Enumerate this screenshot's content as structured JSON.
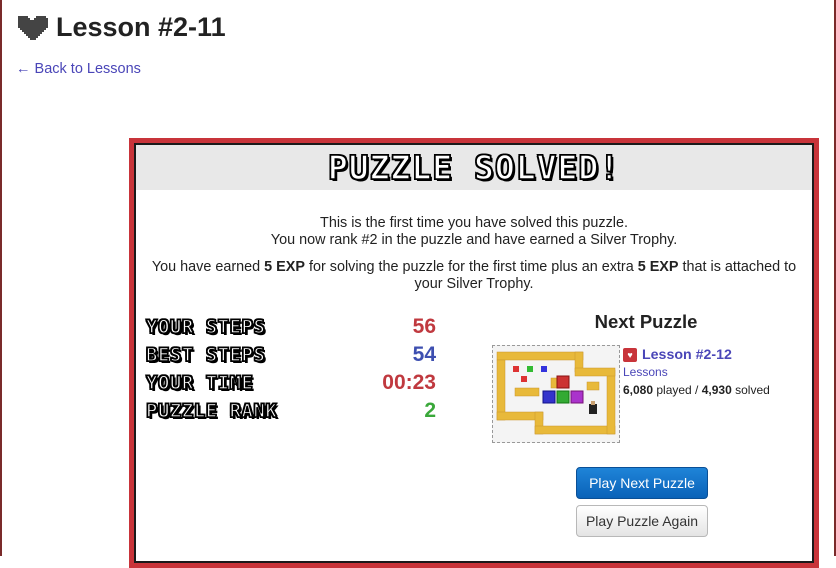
{
  "page": {
    "title": "Lesson #2-11",
    "back_link": "← Back to Lessons"
  },
  "modal": {
    "banner": "PUZZLE SOLVED!",
    "message1_line1": "This is the first time you have solved this puzzle.",
    "message1_line2": "You now rank #2 in the puzzle and have earned a Silver Trophy.",
    "message2_pre": "You have earned ",
    "message2_exp1": "5 EXP",
    "message2_mid": " for solving the puzzle for the first time plus an extra ",
    "message2_exp2": "5 EXP",
    "message2_post": " that is attached to your Silver Trophy.",
    "stats": [
      {
        "label": "YOUR STEPS",
        "value": "56",
        "color": "#c0393f"
      },
      {
        "label": "BEST STEPS",
        "value": "54",
        "color": "#3d4fb0"
      },
      {
        "label": "YOUR TIME",
        "value": "00:23",
        "color": "#c0393f"
      },
      {
        "label": "PUZZLE RANK",
        "value": "2",
        "color": "#3aa83a"
      }
    ]
  },
  "next_puzzle": {
    "heading": "Next Puzzle",
    "name": "Lesson #2-12",
    "category": "Lessons",
    "played": "6,080",
    "played_label": " played / ",
    "solved": "4,930",
    "solved_label": " solved"
  },
  "buttons": {
    "play_next": "Play Next Puzzle",
    "play_again": "Play Puzzle Again"
  },
  "colors": {
    "modal_border": "#c8343a",
    "link": "#4a46b8",
    "primary_button": "#1577cf"
  },
  "icons": {
    "title_icon": "heart-icon",
    "lesson_icon": "heart-icon"
  }
}
